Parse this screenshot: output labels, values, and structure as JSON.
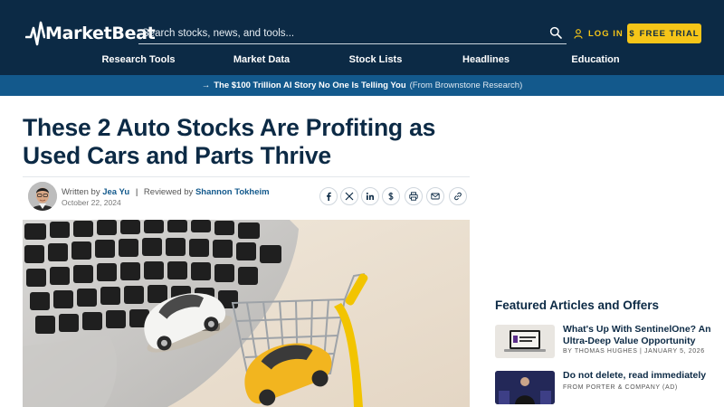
{
  "header": {
    "logo_text": "MarketBeat",
    "search_placeholder": "Search stocks, news, and tools...",
    "login_label": "LOG IN",
    "trial_label": "FREE TRIAL",
    "nav": [
      "Research Tools",
      "Market Data",
      "Stock Lists",
      "Headlines",
      "Education"
    ]
  },
  "promo": {
    "arrow": "→",
    "text": "The $100 Trillion AI Story No One Is Telling You",
    "source": "(From Brownstone Research)"
  },
  "article": {
    "headline": "These 2 Auto Stocks Are Profiting as Used Cars and Parts Thrive",
    "written_by_label": "Written by",
    "author": "Jea Yu",
    "separator": "|",
    "reviewed_by_label": "Reviewed by",
    "reviewer": "Shannon Tokheim",
    "date": "October 22, 2024",
    "share_icons": [
      "facebook-icon",
      "x-icon",
      "linkedin-icon",
      "dollar-icon",
      "print-icon",
      "email-icon",
      "link-icon"
    ]
  },
  "sidebar": {
    "title": "Featured Articles and Offers",
    "cards": [
      {
        "title": "What's Up With SentinelOne? An Ultra-Deep Value Opportunity",
        "meta": "BY THOMAS HUGHES | JANUARY 5, 2026"
      },
      {
        "title": "Do not delete, read immediately",
        "meta": "FROM PORTER & COMPANY (AD)"
      }
    ]
  },
  "colors": {
    "navy": "#0c2a45",
    "promo_blue": "#13598c",
    "accent_yellow": "#f5c518"
  }
}
